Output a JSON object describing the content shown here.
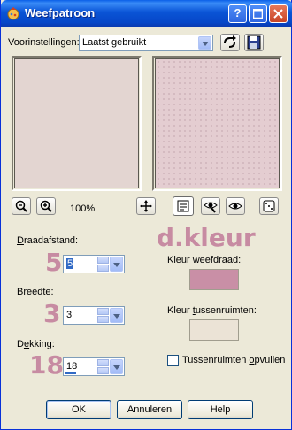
{
  "window": {
    "title": "Weefpatroon"
  },
  "presets": {
    "label": "Voorinstellingen:",
    "value": "Laatst gebruikt"
  },
  "zoom": "100%",
  "thread_width": {
    "label": "Draadafstand:",
    "value": "5",
    "annotation": "5"
  },
  "width": {
    "label": "Breedte:",
    "value": "3",
    "annotation": "3"
  },
  "coverage": {
    "label": "Dekking:",
    "value": "18",
    "annotation": "18"
  },
  "annotation_dkleur": "d.kleur",
  "weave_color": {
    "label": "Kleur weefdraad:",
    "color": "#c98fa6"
  },
  "gap_color": {
    "label": "Kleur tussenruimten:",
    "color": "#ebe3d6"
  },
  "fill_gaps": {
    "label": "Tussenruimten opvullen",
    "checked": false
  },
  "buttons": {
    "ok": "OK",
    "cancel": "Annuleren",
    "help": "Help"
  },
  "colors": {
    "preview_before": "#e3d5d1",
    "preview_after": "#e4cdd1",
    "accent": "#c78ba2"
  }
}
